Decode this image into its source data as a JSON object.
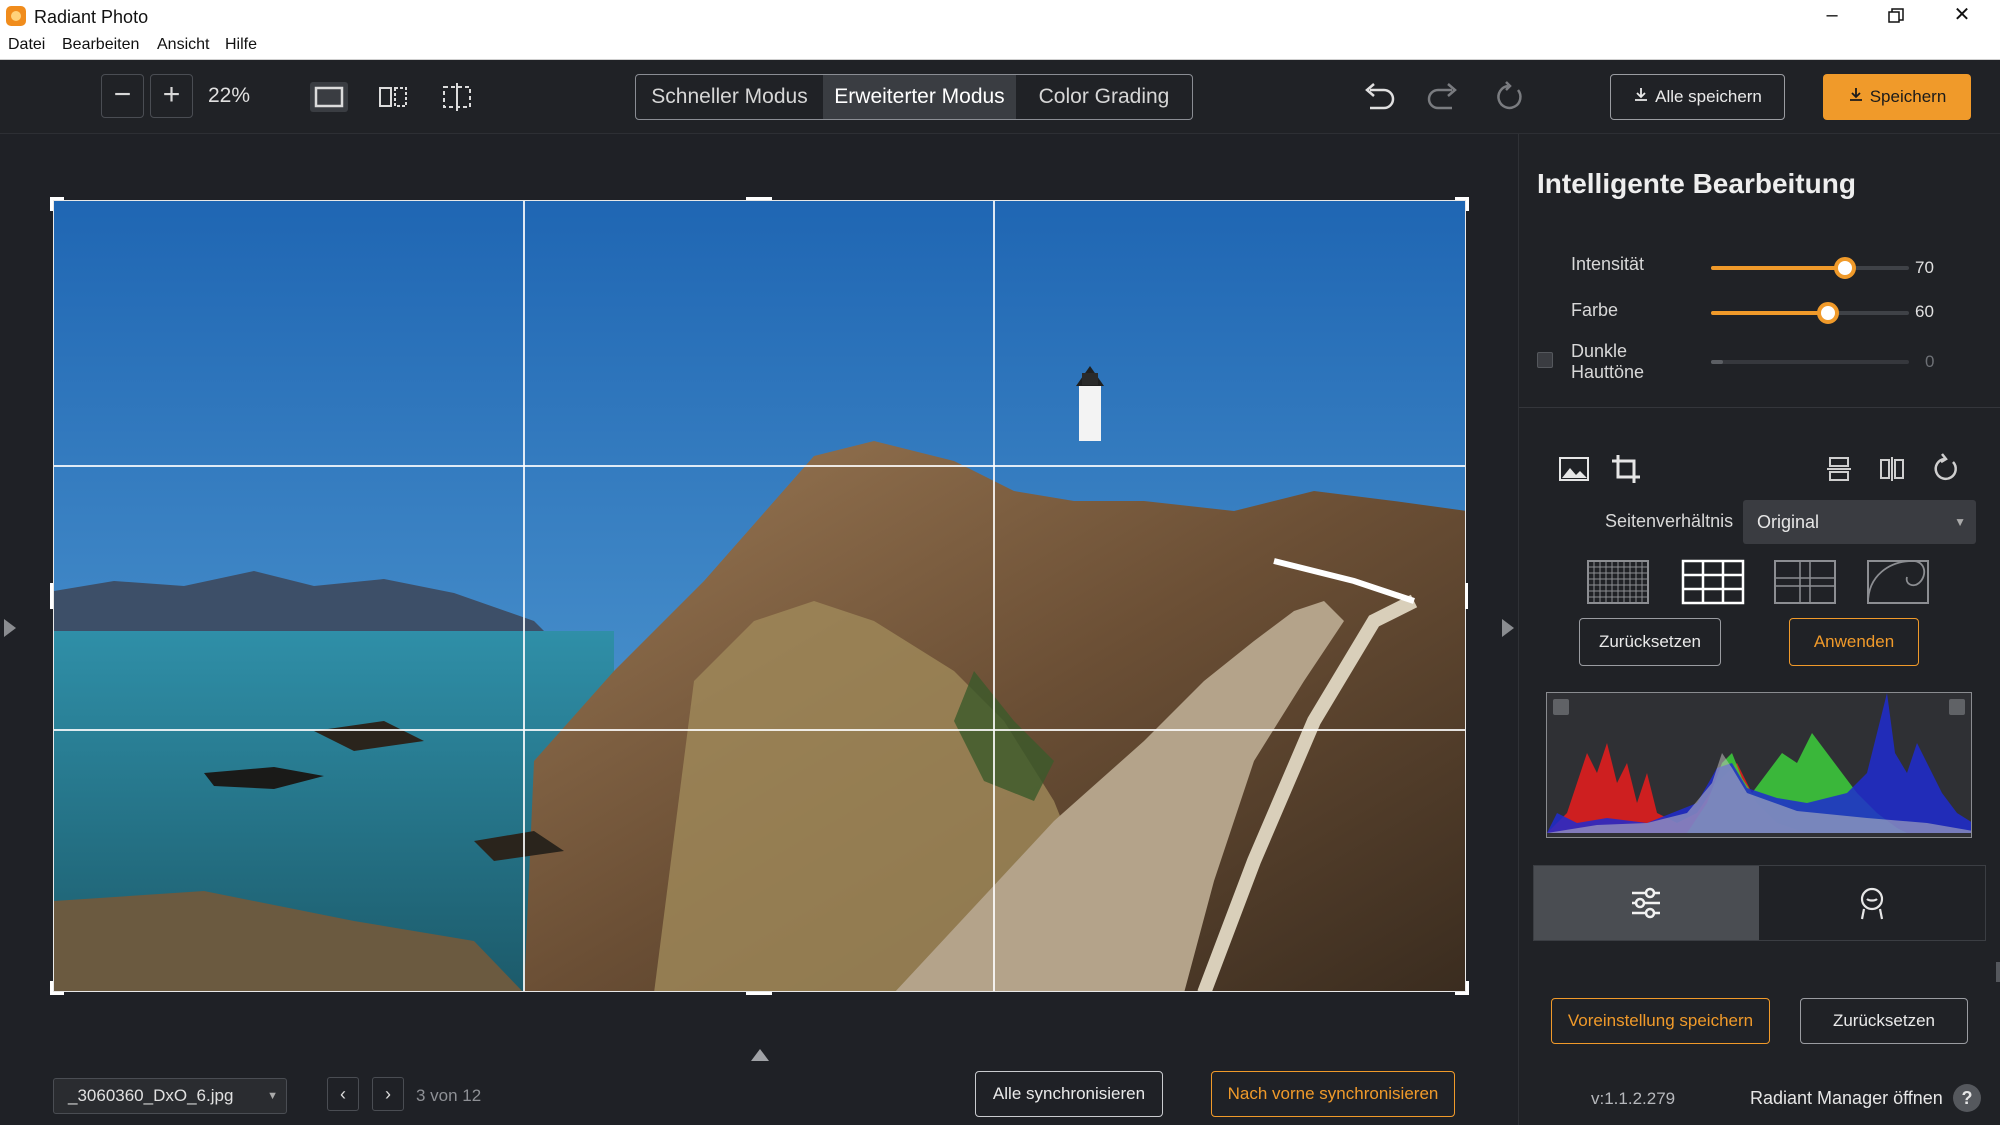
{
  "app": {
    "title": "Radiant Photo"
  },
  "menu": [
    "Datei",
    "Bearbeiten",
    "Ansicht",
    "Hilfe"
  ],
  "toolbar": {
    "zoom_value": "22%",
    "modes": [
      {
        "label": "Schneller Modus",
        "active": false
      },
      {
        "label": "Erweiterter Modus",
        "active": true
      },
      {
        "label": "Color Grading",
        "active": false
      }
    ],
    "save_all_label": "Alle speichern",
    "save_label": "Speichern"
  },
  "panel": {
    "title": "Intelligente Bearbeitung",
    "sliders": [
      {
        "label": "Intensität",
        "value": "70",
        "fraction": 0.7
      },
      {
        "label": "Farbe",
        "value": "60",
        "fraction": 0.6
      },
      {
        "label": "Dunkle Hauttöne",
        "value": "0",
        "fraction": 0.0
      }
    ],
    "aspect_label": "Seitenverhältnis",
    "aspect_value": "Original",
    "reset_label": "Zurücksetzen",
    "apply_label": "Anwenden",
    "save_preset_label": "Voreinstellung speichern",
    "reset_label2": "Zurücksetzen",
    "version": "v:1.1.2.279",
    "manager_label": "Radiant Manager öffnen",
    "help_label": "?"
  },
  "footer": {
    "filename": "_3060360_DxO_6.jpg",
    "position": "3 von 12",
    "sync_all_label": "Alle synchronisieren",
    "sync_forward_label": "Nach vorne synchronisieren"
  },
  "colors": {
    "accent": "#f09a2a",
    "background": "#1f2126"
  },
  "icons": [
    "app-icon",
    "minimize-icon",
    "maximize-icon",
    "close-icon",
    "zoom-out-icon",
    "zoom-in-icon",
    "single-view-icon",
    "split-view-icon",
    "crop-view-icon",
    "undo-icon",
    "redo-icon",
    "reset-icon",
    "download-icon",
    "image-icon",
    "crop-icon",
    "flip-vertical-icon",
    "flip-horizontal-icon",
    "rotate-icon",
    "sliders-icon",
    "face-icon",
    "chevron-left-icon",
    "chevron-right-icon"
  ]
}
